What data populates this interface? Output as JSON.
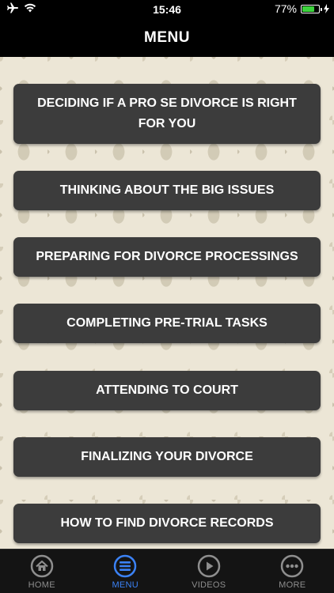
{
  "status": {
    "time": "15:46",
    "battery_text": "77%",
    "battery_level": 0.77,
    "battery_color": "#3cd33c",
    "icons": [
      "airplane-icon",
      "wifi-icon",
      "battery-icon",
      "charging-bolt-icon"
    ]
  },
  "nav": {
    "title": "MENU"
  },
  "menu": {
    "items": [
      {
        "label": "DECIDING IF A PRO SE DIVORCE IS RIGHT FOR YOU"
      },
      {
        "label": "THINKING ABOUT THE BIG ISSUES"
      },
      {
        "label": "PREPARING FOR DIVORCE PROCESSINGS"
      },
      {
        "label": "COMPLETING PRE-TRIAL TASKS"
      },
      {
        "label": "ATTENDING TO COURT"
      },
      {
        "label": "FINALIZING YOUR DIVORCE"
      },
      {
        "label": "HOW TO FIND DIVORCE RECORDS"
      }
    ]
  },
  "tabbar": {
    "active_color": "#3b82f6",
    "tabs": [
      {
        "label": "HOME",
        "icon": "home-icon"
      },
      {
        "label": "MENU",
        "icon": "menu-list-icon",
        "active": true
      },
      {
        "label": "VIDEOS",
        "icon": "play-icon"
      },
      {
        "label": "MORE",
        "icon": "more-dots-icon"
      }
    ]
  }
}
